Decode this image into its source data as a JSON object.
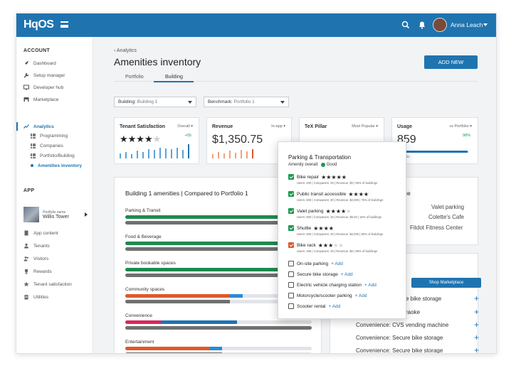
{
  "topbar": {
    "logo": "HqOS",
    "user_name": "Anna Leach"
  },
  "sidebar": {
    "account_label": "ACCOUNT",
    "items": [
      {
        "label": "Dashboard"
      },
      {
        "label": "Setup manager"
      },
      {
        "label": "Developer hub"
      },
      {
        "label": "Marketplace"
      },
      {
        "label": "Analytics"
      }
    ],
    "analytics_sub": [
      {
        "label": "Programming"
      },
      {
        "label": "Companies"
      },
      {
        "label": "Portfolio/Building"
      },
      {
        "label": "Amenities inventory"
      }
    ],
    "app_label": "APP",
    "portfolio_name_label": "Portfolio name",
    "building_name": "Willis Tower",
    "app_items": [
      {
        "label": "App content"
      },
      {
        "label": "Tenants"
      },
      {
        "label": "Visitors"
      },
      {
        "label": "Rewards"
      },
      {
        "label": "Tenant satisfaction"
      },
      {
        "label": "Utilities"
      }
    ]
  },
  "main": {
    "breadcrumb": "Analytics",
    "title": "Amenities inventory",
    "add_button": "ADD NEW",
    "tabs": [
      {
        "label": "Portfolio"
      },
      {
        "label": "Building"
      }
    ],
    "building_select": {
      "label": "Building:",
      "value": "Building 1"
    },
    "benchmark_select": {
      "label": "Benchmark:",
      "value": "Portfolio 1"
    }
  },
  "kpis": {
    "satisfaction": {
      "title": "Tenant Satisfaction",
      "dropdown": "Overall",
      "delta": "+55",
      "stars": "★★★★",
      "stars_off": "★"
    },
    "revenue": {
      "title": "Revenue",
      "dropdown": "In-app",
      "value": "$1,350.75"
    },
    "tx": {
      "title": "TeX Pillar",
      "dropdown": "Most Popular"
    },
    "usage": {
      "title": "Usage",
      "dropdown": "vs Portfolio",
      "value": "859",
      "percent_label": "98%",
      "percent": 0.98,
      "bar_label": "Portfolio"
    }
  },
  "amenities_card": {
    "title": "Building 1 amenities | Compared to Portfolio 1",
    "categories": [
      {
        "label": "Parking & Transit",
        "bars": [
          {
            "color": "#1f8a4c",
            "pct": 100
          },
          {
            "color": "#707070",
            "pct": 100
          }
        ]
      },
      {
        "label": "Food & Beverage",
        "bars": [
          {
            "color": "#1f8a4c",
            "pct": 100
          },
          {
            "color": "#707070",
            "pct": 100
          }
        ]
      },
      {
        "label": "Private bookable spaces",
        "bars": [
          {
            "color": "#1f8a4c",
            "pct": 100
          },
          {
            "color": "#707070",
            "pct": 100
          }
        ]
      },
      {
        "label": "Community spaces",
        "bars": [
          {
            "segments": [
              {
                "color": "#e0572a",
                "pct": 56
              },
              {
                "color": "#2b8ad4",
                "pct": 7
              }
            ]
          },
          {
            "color": "#707070",
            "pct": 56
          }
        ]
      },
      {
        "label": "Convenience",
        "bars": [
          {
            "segments": [
              {
                "color": "#d6295e",
                "pct": 19
              },
              {
                "color": "#1f74b0",
                "pct": 41
              }
            ]
          },
          {
            "color": "#707070",
            "pct": 100
          }
        ]
      },
      {
        "label": "Entertainment",
        "bars": [
          {
            "segments": [
              {
                "color": "#e0572a",
                "pct": 45
              },
              {
                "color": "#2b8ad4",
                "pct": 7
              }
            ]
          },
          {
            "color": "#707070",
            "pct": 52
          }
        ]
      }
    ]
  },
  "right_card": {
    "partial_title": "nce",
    "items": [
      "Valet parking",
      "Colette's Cafe",
      "Fitdot Fitness Center"
    ]
  },
  "shop_card": {
    "partial_title": "s",
    "button": "Shop Marketplace",
    "items": [
      {
        "partial": "e bike storage"
      },
      {
        "partial": "raoke"
      },
      {
        "prefix": "Convenience:",
        "name": "CVS vending machine"
      },
      {
        "prefix": "Convenience:",
        "name": "Secure bike storage"
      },
      {
        "prefix": "Convenience:",
        "name": "Secure bike storage"
      }
    ]
  },
  "popover": {
    "title": "Parking & Transportation",
    "overall_label": "Amenity overall:",
    "overall_value": "Good",
    "items": [
      {
        "label": "Bike repair",
        "checked": true,
        "stars": "★★★★★",
        "stars_off": "",
        "meta": "Users: 400 | Companies: 25 | Revenue: $0 | 90% of buildings"
      },
      {
        "label": "Public transit accessible",
        "checked": true,
        "stars": "★★★★",
        "stars_off": "",
        "meta": "Users: 500 | Companies: 30 | Revenue: $2,000 | 75% of buildings"
      },
      {
        "label": "Valet parking",
        "checked": true,
        "stars": "★★★★",
        "stars_off": "★",
        "meta": "Users: 800 | Companies: 30 | Revenue: $5.00 | 15% of buildings"
      },
      {
        "label": "Shuttle",
        "checked": true,
        "stars": "★★★★",
        "stars_off": "",
        "meta": "Users: 500 | Companies: 30 | Revenue: $2,000 | 80% of buildings"
      },
      {
        "label": "Bike rack",
        "checked": true,
        "orange": true,
        "stars": "★★★",
        "stars_off": "★★",
        "meta": "Users: 456 | Companies: 30 | Revenue: $0 | 85% of buildings"
      },
      {
        "label": "On-site parking",
        "checked": false,
        "add": "+ Add"
      },
      {
        "label": "Secure bike storage",
        "checked": false,
        "add": "+ Add"
      },
      {
        "label": "Electric vehicle charging station",
        "checked": false,
        "add": "+ Add"
      },
      {
        "label": "Motorcycle/scooter parking",
        "checked": false,
        "add": "+ Add"
      },
      {
        "label": "Scooter rental",
        "checked": false,
        "add": "+ Add"
      }
    ]
  },
  "colors": {
    "brand": "#1f74b0",
    "good": "#1a9a52",
    "warning": "#e0572a"
  }
}
